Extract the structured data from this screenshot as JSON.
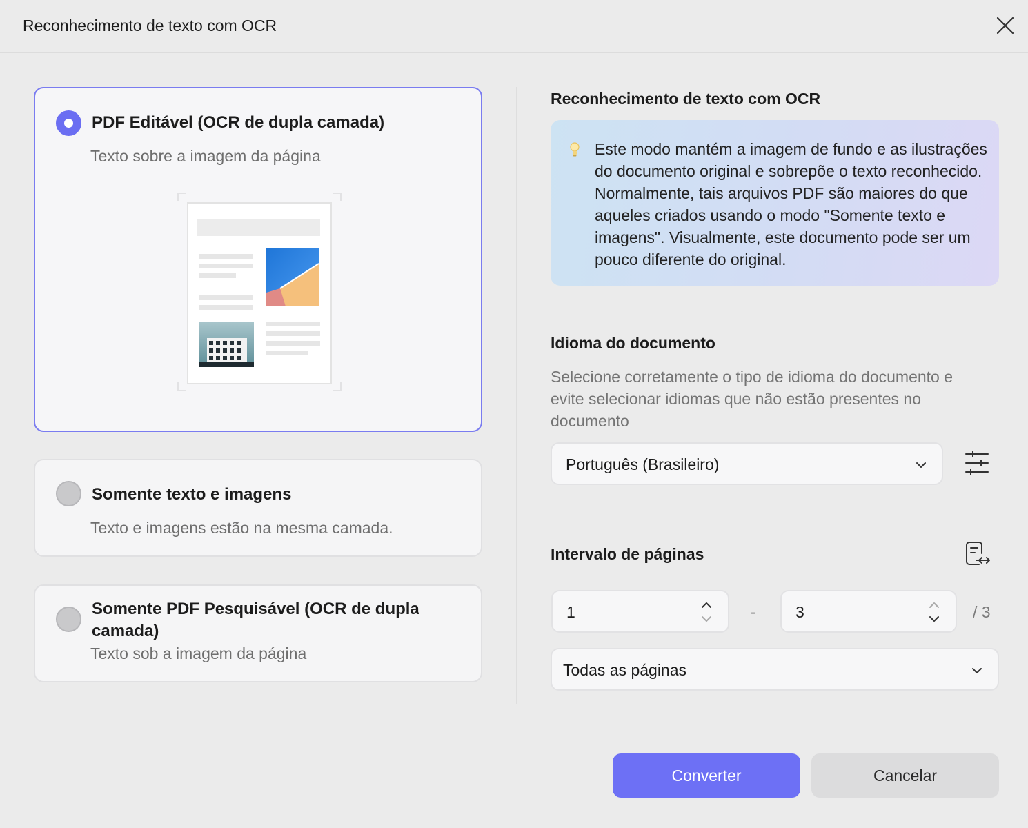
{
  "dialog": {
    "title": "Reconhecimento de texto com OCR"
  },
  "options": [
    {
      "title": "PDF Editável (OCR de dupla camada)",
      "subtitle": "Texto sobre a imagem da página",
      "selected": true
    },
    {
      "title": "Somente texto e imagens",
      "subtitle": "Texto e imagens estão na mesma camada.",
      "selected": false
    },
    {
      "title": "Somente PDF Pesquisável (OCR de dupla camada)",
      "subtitle": "Texto sob a imagem da página",
      "selected": false
    }
  ],
  "right": {
    "heading": "Reconhecimento de texto com OCR",
    "info": "Este modo mantém a imagem de fundo e as ilustrações do documento original e sobrepõe o texto reconhecido. Normalmente, tais arquivos PDF são maiores do que aqueles criados usando o modo \"Somente texto e imagens\". Visualmente, este documento pode ser um pouco diferente do original.",
    "language": {
      "heading": "Idioma do documento",
      "description": "Selecione corretamente o tipo de idioma do documento e evite selecionar idiomas que não estão presentes no documento",
      "selected": "Português (Brasileiro)"
    },
    "pages": {
      "heading": "Intervalo de páginas",
      "from": "1",
      "separator": "-",
      "to": "3",
      "total": "/ 3",
      "scope": "Todas as páginas"
    }
  },
  "buttons": {
    "convert": "Converter",
    "cancel": "Cancelar"
  },
  "colors": {
    "accent": "#6d70f5",
    "selected_border": "#7a7cf0"
  }
}
